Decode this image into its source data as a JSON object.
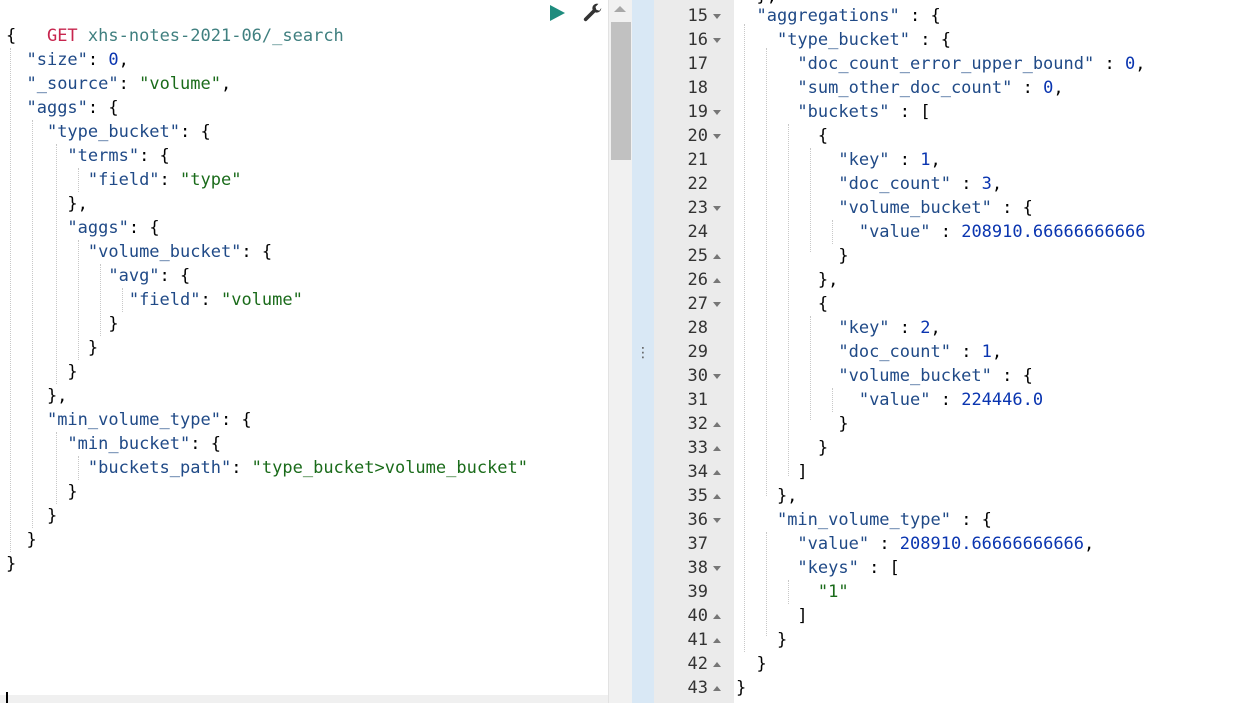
{
  "request": {
    "method": "GET",
    "url": "xhs-notes-2021-06/_search",
    "lines": [
      "{",
      "  \"size\": 0,",
      "  \"_source\": \"volume\",",
      "  \"aggs\": {",
      "    \"type_bucket\": {",
      "      \"terms\": {",
      "        \"field\": \"type\"",
      "      },",
      "      \"aggs\": {",
      "        \"volume_bucket\": {",
      "          \"avg\": {",
      "            \"field\": \"volume\"",
      "          }",
      "        }",
      "      }",
      "    },",
      "    \"min_volume_type\": {",
      "      \"min_bucket\": {",
      "        \"buckets_path\": \"type_bucket>volume_bucket\"",
      "      }",
      "    }",
      "  }",
      "}"
    ]
  },
  "response": {
    "partial_top": "  },",
    "rows": [
      {
        "n": "15",
        "fold": "open",
        "text": "  \"aggregations\" : {"
      },
      {
        "n": "16",
        "fold": "open",
        "text": "    \"type_bucket\" : {"
      },
      {
        "n": "17",
        "fold": "",
        "text": "      \"doc_count_error_upper_bound\" : 0,"
      },
      {
        "n": "18",
        "fold": "",
        "text": "      \"sum_other_doc_count\" : 0,"
      },
      {
        "n": "19",
        "fold": "open",
        "text": "      \"buckets\" : ["
      },
      {
        "n": "20",
        "fold": "open",
        "text": "        {"
      },
      {
        "n": "21",
        "fold": "",
        "text": "          \"key\" : 1,"
      },
      {
        "n": "22",
        "fold": "",
        "text": "          \"doc_count\" : 3,"
      },
      {
        "n": "23",
        "fold": "open",
        "text": "          \"volume_bucket\" : {"
      },
      {
        "n": "24",
        "fold": "",
        "text": "            \"value\" : 208910.66666666666"
      },
      {
        "n": "25",
        "fold": "close",
        "text": "          }"
      },
      {
        "n": "26",
        "fold": "close",
        "text": "        },"
      },
      {
        "n": "27",
        "fold": "open",
        "text": "        {"
      },
      {
        "n": "28",
        "fold": "",
        "text": "          \"key\" : 2,"
      },
      {
        "n": "29",
        "fold": "",
        "text": "          \"doc_count\" : 1,"
      },
      {
        "n": "30",
        "fold": "open",
        "text": "          \"volume_bucket\" : {"
      },
      {
        "n": "31",
        "fold": "",
        "text": "            \"value\" : 224446.0"
      },
      {
        "n": "32",
        "fold": "close",
        "text": "          }"
      },
      {
        "n": "33",
        "fold": "close",
        "text": "        }"
      },
      {
        "n": "34",
        "fold": "close",
        "text": "      ]"
      },
      {
        "n": "35",
        "fold": "close",
        "text": "    },"
      },
      {
        "n": "36",
        "fold": "open",
        "text": "    \"min_volume_type\" : {"
      },
      {
        "n": "37",
        "fold": "",
        "text": "      \"value\" : 208910.66666666666,"
      },
      {
        "n": "38",
        "fold": "open",
        "text": "      \"keys\" : ["
      },
      {
        "n": "39",
        "fold": "",
        "text": "        \"1\""
      },
      {
        "n": "40",
        "fold": "close",
        "text": "      ]"
      },
      {
        "n": "41",
        "fold": "close",
        "text": "    }"
      },
      {
        "n": "42",
        "fold": "close",
        "text": "  }"
      },
      {
        "n": "43",
        "fold": "close",
        "text": "}"
      }
    ]
  },
  "icons": {
    "run": "play-icon",
    "settings": "wrench-icon",
    "splitter": "vertical-ellipsis"
  },
  "colors": {
    "method": "#c7254e",
    "url": "#3f7f7f",
    "key": "#204a87",
    "string": "#1a6b1a",
    "number": "#0a35b0",
    "run_button": "#1e8c7e",
    "splitter": "#d9e8f5",
    "gutter": "#ebebeb"
  }
}
